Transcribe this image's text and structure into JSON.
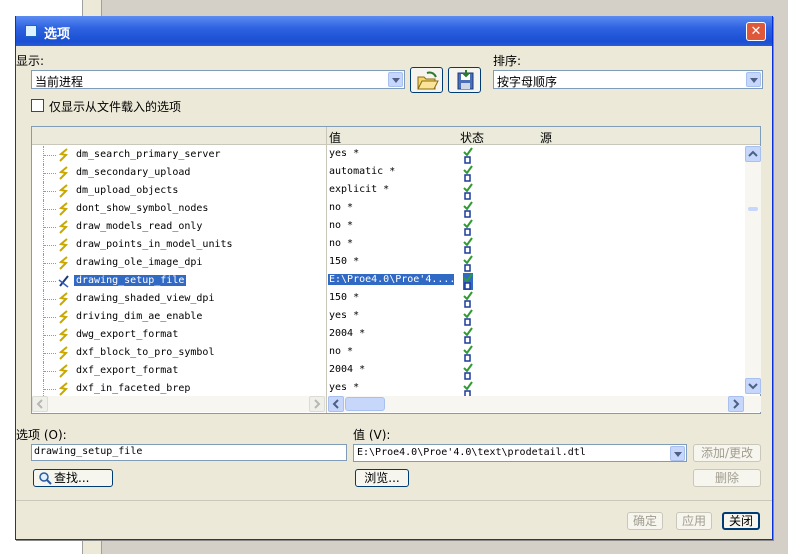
{
  "window": {
    "title": "选项",
    "close": "✕"
  },
  "display": {
    "label": "显示:",
    "value": "当前进程"
  },
  "sort": {
    "label": "排序:",
    "value": "按字母顺序"
  },
  "only_from_file": {
    "label": "仅显示从文件载入的选项",
    "checked": false
  },
  "table": {
    "headers": {
      "value": "值",
      "status": "状态",
      "source": "源"
    },
    "rows": [
      {
        "name": "dm_search_primary_server",
        "value": "yes *"
      },
      {
        "name": "dm_secondary_upload",
        "value": "automatic *"
      },
      {
        "name": "dm_upload_objects",
        "value": "explicit *"
      },
      {
        "name": "dont_show_symbol_nodes",
        "value": "no *"
      },
      {
        "name": "draw_models_read_only",
        "value": "no *"
      },
      {
        "name": "draw_points_in_model_units",
        "value": "no *"
      },
      {
        "name": "drawing_ole_image_dpi",
        "value": "150 *"
      },
      {
        "name": "drawing_setup_file",
        "value": "E:\\Proe4.0\\Proe'4....",
        "selected": true
      },
      {
        "name": "drawing_shaded_view_dpi",
        "value": "150 *"
      },
      {
        "name": "driving_dim_ae_enable",
        "value": "yes *"
      },
      {
        "name": "dwg_export_format",
        "value": "2004 *"
      },
      {
        "name": "dxf_block_to_pro_symbol",
        "value": "no *"
      },
      {
        "name": "dxf_export_format",
        "value": "2004 *"
      },
      {
        "name": "dxf_in_faceted_brep",
        "value": "yes *"
      }
    ]
  },
  "option": {
    "label": "选项 (O):",
    "value": "drawing_setup_file"
  },
  "value_field": {
    "label": "值 (V):",
    "value": "E:\\Proe4.0\\Proe'4.0\\text\\prodetail.dtl"
  },
  "buttons": {
    "add_change": "添加/更改",
    "delete": "删除",
    "find": "查找...",
    "browse": "浏览...",
    "ok": "确定",
    "apply": "应用",
    "close": "关闭"
  },
  "colors": {
    "titlebar": "#2e62e0",
    "selection": "#316ac5",
    "status_check": "#2e9c2e"
  }
}
